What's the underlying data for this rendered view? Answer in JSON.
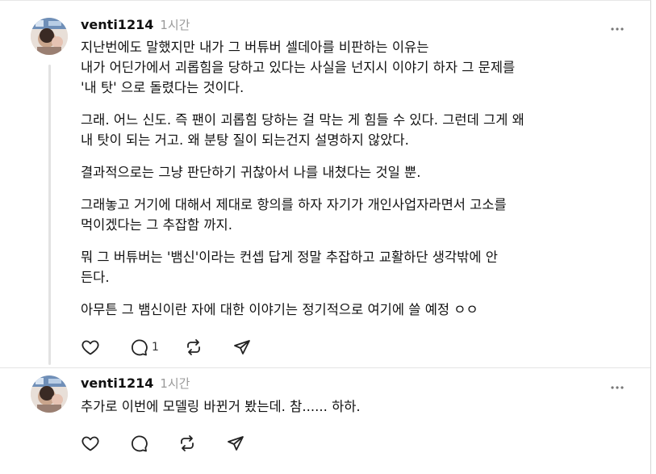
{
  "comments": [
    {
      "username": "venti1214",
      "time": "1시간",
      "paragraphs": [
        "지난번에도 말했지만 내가 그 버튜버 셀데아를 비판하는 이유는\n내가 어딘가에서 괴롭힘을 당하고 있다는 사실을 넌지시 이야기 하자 그 문제를\n'내 탓' 으로 돌렸다는 것이다.",
        "그래. 어느 신도. 즉 팬이 괴롭힘 당하는 걸 막는 게 힘들 수 있다. 그런데 그게 왜\n내 탓이 되는 거고. 왜 분탕 질이 되는건지 설명하지 않았다.",
        "결과적으로는 그냥 판단하기 귀찮아서 나를 내쳤다는 것일 뿐.",
        "그래놓고 거기에 대해서 제대로 항의를 하자 자기가 개인사업자라면서 고소를\n먹이겠다는 그 추잡함 까지.",
        "뭐 그 버튜버는 '뱀신'이라는 컨셉 답게 정말 추잡하고 교활하단 생각밖에 안\n든다.",
        "아무튼 그 뱀신이란 자에 대한 이야기는 정기적으로 여기에 쓸 예정 ㅇㅇ"
      ],
      "reply_count": "1"
    },
    {
      "username": "venti1214",
      "time": "1시간",
      "paragraphs": [
        "추가로 이번에 모델링 바뀐거 봤는데. 참...... 하하."
      ],
      "reply_count": ""
    }
  ],
  "icons": {
    "like": "heart-icon",
    "reply": "speech-bubble-icon",
    "repost": "repost-icon",
    "share": "send-icon",
    "more": "more-dots-icon"
  },
  "colors": {
    "text": "#101010",
    "muted": "#9a9a9a",
    "thread_line": "#e2e2e2"
  }
}
